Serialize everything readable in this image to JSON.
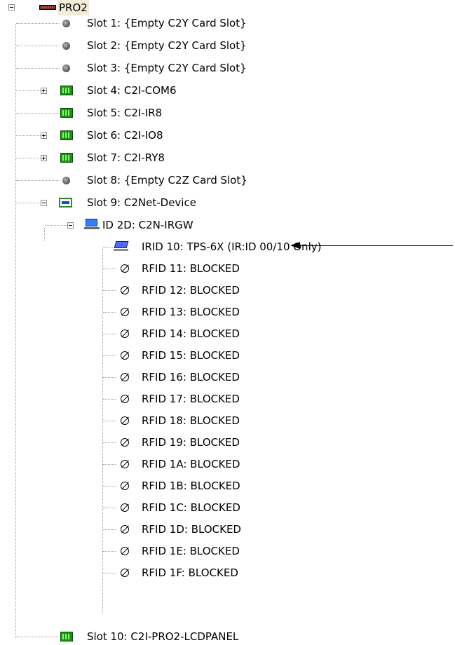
{
  "tree": {
    "root": {
      "label": "PRO2",
      "icon": "pro2-processor-icon"
    },
    "slots": [
      {
        "label": "Slot 1: {Empty C2Y Card Slot}",
        "icon": "empty-slot-icon"
      },
      {
        "label": "Slot 2: {Empty C2Y Card Slot}",
        "icon": "empty-slot-icon"
      },
      {
        "label": "Slot 3: {Empty C2Y Card Slot}",
        "icon": "empty-slot-icon"
      },
      {
        "label": "Slot 4: C2I-COM6",
        "icon": "card-icon"
      },
      {
        "label": "Slot 5: C2I-IR8",
        "icon": "card-icon"
      },
      {
        "label": "Slot 6: C2I-IO8",
        "icon": "card-icon"
      },
      {
        "label": "Slot 7: C2I-RY8",
        "icon": "card-icon"
      },
      {
        "label": "Slot 8: {Empty C2Z Card Slot}",
        "icon": "empty-slot-icon"
      },
      {
        "label": "Slot 9: C2Net-Device",
        "icon": "network-card-icon"
      },
      {
        "label": "Slot 10: C2I-PRO2-LCDPANEL",
        "icon": "card-icon"
      }
    ],
    "device": {
      "label": "ID 2D: C2N-IRGW",
      "icon": "ir-gateway-icon"
    },
    "children": [
      {
        "label": "IRID 10: TPS-6X (IR:ID 00/10 Only)",
        "icon": "touchpanel-icon"
      },
      {
        "label": "RFID 11: BLOCKED",
        "icon": "blocked-icon"
      },
      {
        "label": "RFID 12: BLOCKED",
        "icon": "blocked-icon"
      },
      {
        "label": "RFID 13: BLOCKED",
        "icon": "blocked-icon"
      },
      {
        "label": "RFID 14: BLOCKED",
        "icon": "blocked-icon"
      },
      {
        "label": "RFID 15: BLOCKED",
        "icon": "blocked-icon"
      },
      {
        "label": "RFID 16: BLOCKED",
        "icon": "blocked-icon"
      },
      {
        "label": "RFID 17: BLOCKED",
        "icon": "blocked-icon"
      },
      {
        "label": "RFID 18: BLOCKED",
        "icon": "blocked-icon"
      },
      {
        "label": "RFID 19: BLOCKED",
        "icon": "blocked-icon"
      },
      {
        "label": "RFID 1A: BLOCKED",
        "icon": "blocked-icon"
      },
      {
        "label": "RFID 1B: BLOCKED",
        "icon": "blocked-icon"
      },
      {
        "label": "RFID 1C: BLOCKED",
        "icon": "blocked-icon"
      },
      {
        "label": "RFID 1D: BLOCKED",
        "icon": "blocked-icon"
      },
      {
        "label": "RFID 1E: BLOCKED",
        "icon": "blocked-icon"
      },
      {
        "label": "RFID 1F: BLOCKED",
        "icon": "blocked-icon"
      }
    ]
  },
  "annotation": {
    "icon": "left-arrow-icon"
  },
  "colors": {
    "root_highlight": "#f1ecd9",
    "card_green": "#1f8d16",
    "tree_line": "#a0a0a0"
  }
}
